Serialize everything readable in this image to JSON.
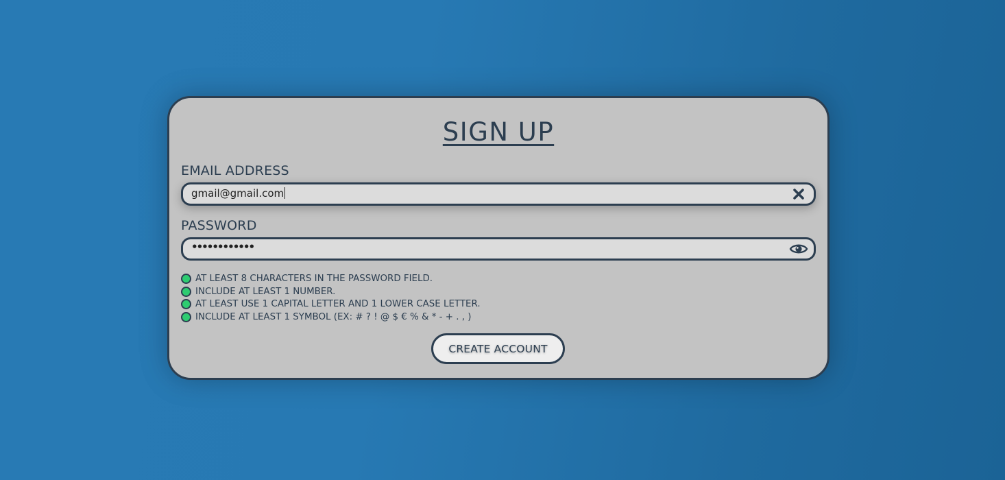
{
  "form": {
    "title": "SIGN UP",
    "email": {
      "label": "EMAIL ADDRESS",
      "value": "gmail@gmail.com",
      "clear_icon": "close-icon"
    },
    "password": {
      "label": "PASSWORD",
      "masked_value": "••••••••••••",
      "visibility_icon": "eye-icon"
    },
    "requirements": [
      {
        "text": "AT LEAST 8 CHARACTERS IN THE PASSWORD FIELD.",
        "status": "met"
      },
      {
        "text": "INCLUDE AT LEAST 1 NUMBER.",
        "status": "met"
      },
      {
        "text": "AT LEAST USE 1 CAPITAL LETTER AND 1 LOWER CASE LETTER.",
        "status": "met"
      },
      {
        "text": "INCLUDE AT LEAST 1 SYMBOL (EX: # ? ! @ $ € % & * - + . , )",
        "status": "met"
      }
    ],
    "submit_label": "CREATE ACCOUNT"
  },
  "colors": {
    "background": "#2779b3",
    "card": "#c3c3c3",
    "border": "#2c3e50",
    "input": "#dcdcdc",
    "requirement_met": "#2ecc71"
  }
}
